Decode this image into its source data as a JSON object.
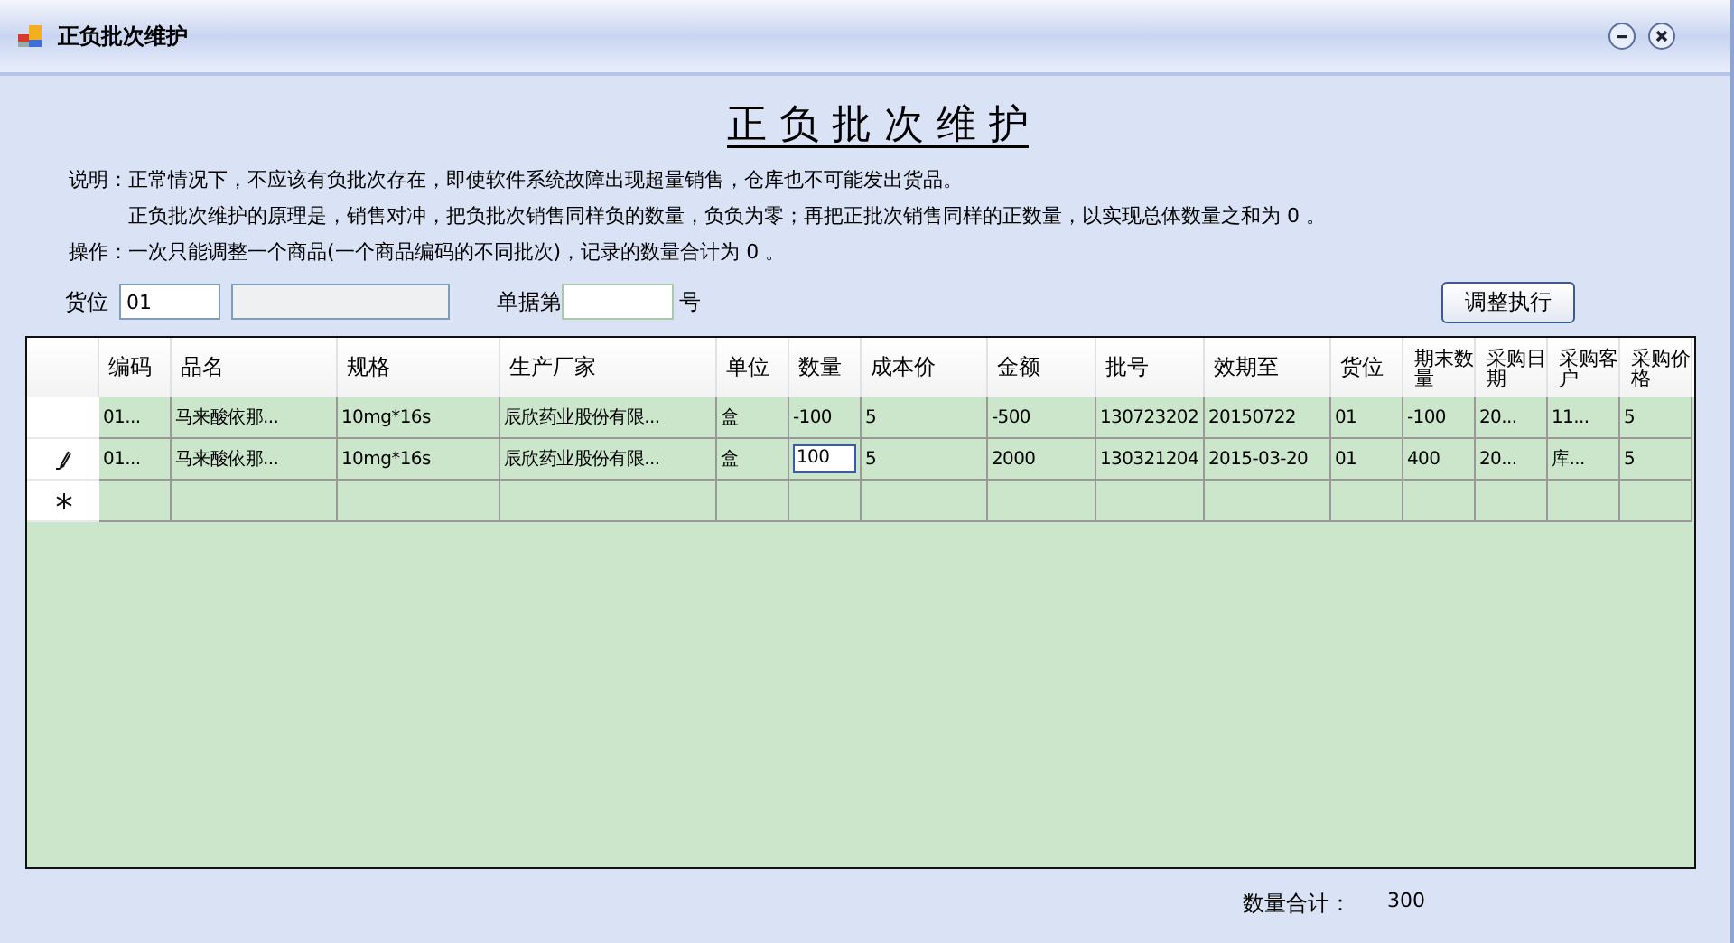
{
  "window": {
    "title": "正负批次维护"
  },
  "heading": "正 负 批 次 维 护",
  "notes": [
    {
      "label": "说明：",
      "lines": [
        "正常情况下，不应该有负批次存在，即使软件系统故障出现超量销售，仓库也不可能发出货品。",
        "正负批次维护的原理是，销售对冲，把负批次销售同样负的数量，负负为零；再把正批次销售同样的正数量，以实现总体数量之和为 0 。"
      ]
    },
    {
      "label": "操作：",
      "lines": [
        "一次只能调整一个商品(一个商品编码的不同批次)，记录的数量合计为 0 。"
      ]
    }
  ],
  "filters": {
    "location_label": "货位",
    "location_value": "01",
    "doc_label": "单据第",
    "doc_suffix": "号",
    "execute_button": "调整执行"
  },
  "table": {
    "columns": [
      "编码",
      "品名",
      "规格",
      "生产厂家",
      "单位",
      "数量",
      "成本价",
      "金额",
      "批号",
      "效期至",
      "货位",
      "期末数量",
      "采购日期",
      "采购客户",
      "采购价格"
    ],
    "rows": [
      {
        "kind": "data",
        "editing": false,
        "cells": [
          "01...",
          "马来酸依那...",
          "10mg*16s",
          "辰欣药业股份有限...",
          "盒",
          "-100",
          "5",
          "-500",
          "130723202",
          "20150722",
          "01",
          "-100",
          "20...",
          "11...",
          "5"
        ]
      },
      {
        "kind": "data",
        "editing": true,
        "cells": [
          "01...",
          "马来酸依那...",
          "10mg*16s",
          "辰欣药业股份有限...",
          "盒",
          "100",
          "5",
          "2000",
          "130321204",
          "2015-03-20",
          "01",
          "400",
          "20...",
          "库...",
          "5"
        ]
      },
      {
        "kind": "new",
        "editing": false,
        "cells": []
      }
    ]
  },
  "footer": {
    "total_label": "数量合计：",
    "total_value": "300"
  }
}
